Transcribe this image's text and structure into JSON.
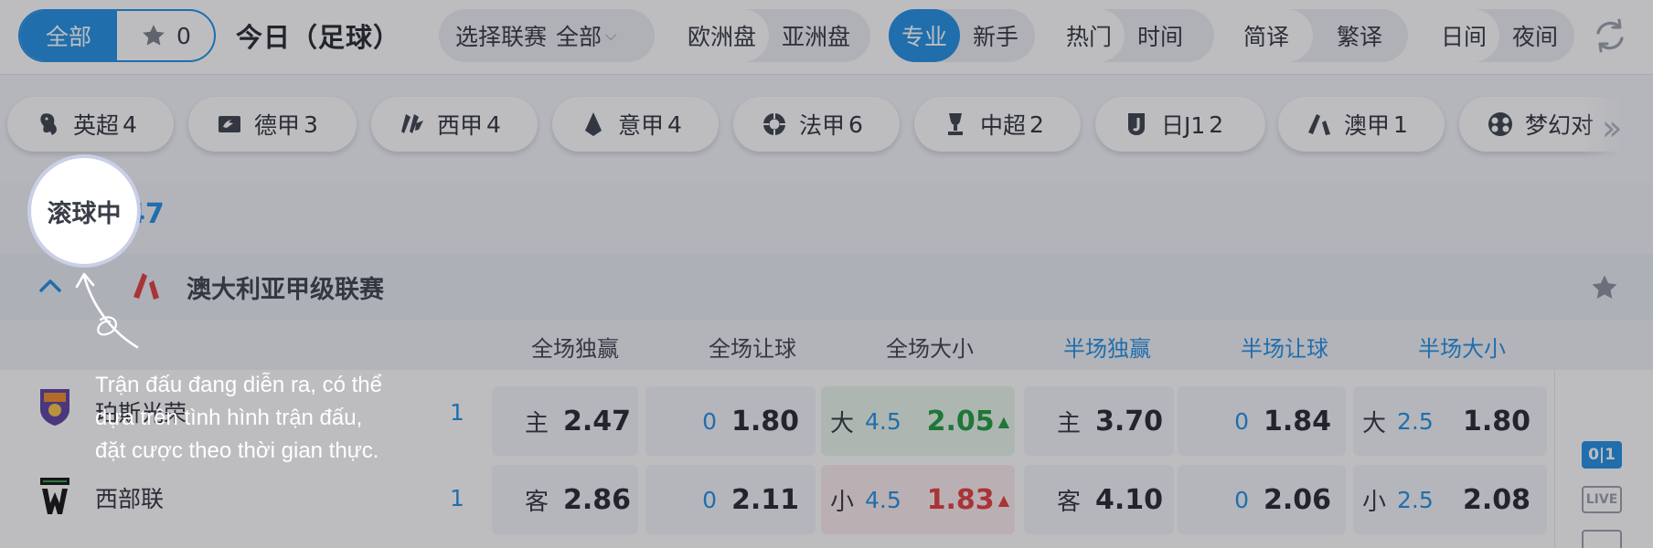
{
  "toolbar": {
    "all_label": "全部",
    "favorites_count": "0",
    "title": "今日（足球）",
    "league_select": {
      "label": "选择联赛",
      "value": "全部"
    },
    "odds_type": [
      "欧洲盘",
      "亚洲盘"
    ],
    "mode": [
      "专业",
      "新手"
    ],
    "sort": [
      "热门",
      "时间"
    ],
    "lang": [
      "简译",
      "繁译"
    ],
    "daynight": [
      "日间",
      "夜间"
    ]
  },
  "leagues": [
    {
      "name": "英超",
      "count": "4",
      "icon": "premier-league-icon"
    },
    {
      "name": "德甲",
      "count": "3",
      "icon": "bundesliga-icon"
    },
    {
      "name": "西甲",
      "count": "4",
      "icon": "laliga-icon"
    },
    {
      "name": "意甲",
      "count": "4",
      "icon": "serie-a-icon"
    },
    {
      "name": "法甲",
      "count": "6",
      "icon": "ligue1-icon"
    },
    {
      "name": "中超",
      "count": "2",
      "icon": "csl-icon"
    },
    {
      "name": "日J1",
      "count": "2",
      "icon": "j-league-icon"
    },
    {
      "name": "澳甲",
      "count": "1",
      "icon": "a-league-icon"
    },
    {
      "name": "梦幻对",
      "count": "",
      "icon": "fantasy-icon"
    }
  ],
  "live": {
    "count": "47"
  },
  "league_group": {
    "name": "澳大利亚甲级联赛"
  },
  "columns": [
    "全场独赢",
    "全场让球",
    "全场大小",
    "半场独赢",
    "半场让球",
    "半场大小"
  ],
  "matches": [
    {
      "team": "珀斯光荣",
      "score": "1",
      "ft_1x2": {
        "pre": "主",
        "odds": "2.47"
      },
      "ft_hdp": {
        "line": "0",
        "odds": "1.80"
      },
      "ft_ou": {
        "pre": "大",
        "line": "4.5",
        "odds": "2.05",
        "trend": "up"
      },
      "ht_1x2": {
        "pre": "主",
        "odds": "3.70"
      },
      "ht_hdp": {
        "line": "0",
        "odds": "1.84"
      },
      "ht_ou": {
        "pre": "大",
        "line": "2.5",
        "odds": "1.80"
      }
    },
    {
      "team": "西部联",
      "score": "1",
      "ft_1x2": {
        "pre": "客",
        "odds": "2.86"
      },
      "ft_hdp": {
        "line": "0",
        "odds": "2.11"
      },
      "ft_ou": {
        "pre": "小",
        "line": "4.5",
        "odds": "1.83",
        "trend": "down"
      },
      "ht_1x2": {
        "pre": "客",
        "odds": "4.10"
      },
      "ht_hdp": {
        "line": "0",
        "odds": "2.06"
      },
      "ht_ou": {
        "pre": "小",
        "line": "2.5",
        "odds": "2.08"
      }
    }
  ],
  "side": {
    "score_badge": "0|1",
    "live_badge": "LIVE"
  },
  "tutorial": {
    "spotlight": "滚球中",
    "text": "Trận đấu đang diễn ra, có thể\ndựa trên tình hình trận đấu,\nđặt cược theo thời gian thực."
  },
  "colors": {
    "accent": "#1f8fe3",
    "odds_up": "#1c9b3a",
    "odds_down": "#e23b3b"
  }
}
